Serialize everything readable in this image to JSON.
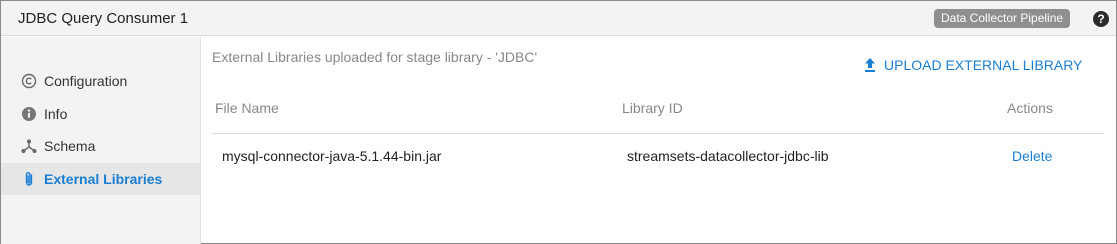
{
  "window": {
    "title": "JDBC Query Consumer 1",
    "badge": "Data Collector Pipeline",
    "help_icon": "help-icon"
  },
  "sidebar": {
    "items": [
      {
        "label": "Configuration",
        "icon": "copyright-circle-icon",
        "active": false
      },
      {
        "label": "Info",
        "icon": "info-icon",
        "active": false
      },
      {
        "label": "Schema",
        "icon": "schema-icon",
        "active": false
      },
      {
        "label": "External Libraries",
        "icon": "paperclip-icon",
        "active": true
      }
    ]
  },
  "main": {
    "subtitle": "External Libraries uploaded for stage library - 'JDBC'",
    "upload_label": "UPLOAD EXTERNAL LIBRARY",
    "upload_icon": "upload-icon",
    "table": {
      "headers": [
        "File Name",
        "Library ID",
        "Actions"
      ],
      "rows": [
        {
          "file_name": "mysql-connector-java-5.1.44-bin.jar",
          "library_id": "streamsets-datacollector-jdbc-lib",
          "action": "Delete"
        }
      ]
    }
  },
  "colors": {
    "accent": "#1a7fd4",
    "badge_bg": "#8f8f8f",
    "sidebar_bg": "#f3f3f3",
    "active_bg": "#e6e6e6"
  }
}
